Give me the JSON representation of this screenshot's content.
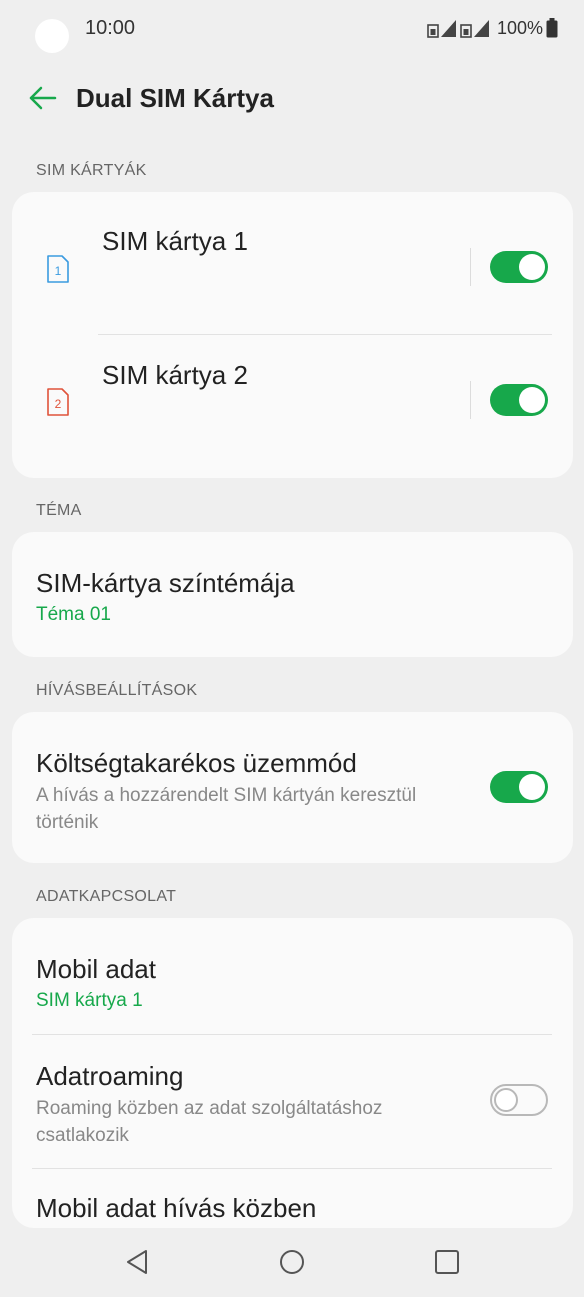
{
  "status": {
    "time": "10:00",
    "battery": "100%"
  },
  "appbar": {
    "title": "Dual SIM Kártya"
  },
  "sim_cards": {
    "header": "SIM KÁRTYÁK",
    "items": [
      {
        "label": "SIM kártya 1",
        "icon_number": "1",
        "enabled": true
      },
      {
        "label": "SIM kártya 2",
        "icon_number": "2",
        "enabled": true
      }
    ]
  },
  "theme": {
    "header": "TÉMA",
    "label": "SIM-kártya színtémája",
    "value": "Téma 01"
  },
  "call_settings": {
    "header": "HÍVÁSBEÁLLÍTÁSOK",
    "label": "Költségtakarékos üzemmód",
    "desc_line1": "A hívás a hozzárendelt SIM kártyán keresztül",
    "desc_line2": "történik",
    "enabled": true
  },
  "data_connection": {
    "header": "ADATKAPCSOLAT",
    "mobile_data": {
      "label": "Mobil adat",
      "value": "SIM kártya 1"
    },
    "roaming": {
      "label": "Adatroaming",
      "desc_line1": "Roaming közben az adat szolgáltatáshoz",
      "desc_line2": "csatlakozik",
      "enabled": false
    },
    "data_during_call": {
      "label": "Mobil adat hívás közben"
    }
  },
  "colors": {
    "accent": "#17a84b",
    "sim1": "#3a9be0",
    "sim2": "#e0533a"
  }
}
